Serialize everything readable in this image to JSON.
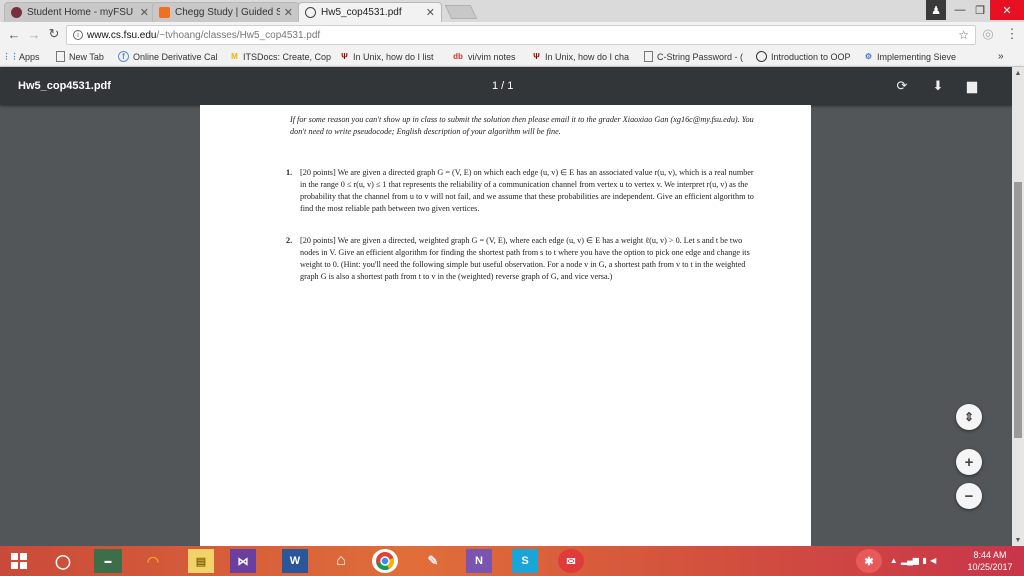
{
  "browser": {
    "tabs": [
      {
        "label": "Student Home - myFSU",
        "icon": "fsu-icon",
        "color": "#782f40"
      },
      {
        "label": "Chegg Study | Guided So",
        "icon": "chegg-icon",
        "color": "#f26f21"
      },
      {
        "label": "Hw5_cop4531.pdf",
        "icon": "globe-icon",
        "color": "#333333"
      }
    ],
    "url_host": "www.cs.fsu.edu",
    "url_path": "/~tvhoang/classes/Hw5_cop4531.pdf",
    "bookmarks": [
      {
        "label": "Apps",
        "icon": "apps-grid-icon"
      },
      {
        "label": "New Tab",
        "icon": "page-icon"
      },
      {
        "label": "Online Derivative Cal",
        "icon": "derivative-icon"
      },
      {
        "label": "ITSDocs: Create, Cop",
        "icon": "itsdocs-icon"
      },
      {
        "label": "In Unix, how do I list",
        "icon": "iu-icon"
      },
      {
        "label": "vi/vim notes",
        "icon": "db-icon"
      },
      {
        "label": "In Unix, how do I cha",
        "icon": "iu-icon"
      },
      {
        "label": "C-String Password - (",
        "icon": "page-icon"
      },
      {
        "label": "Introduction to OOP",
        "icon": "globe-icon"
      },
      {
        "label": "Implementing Sieve",
        "icon": "implementing-icon"
      }
    ],
    "bookmarks_overflow": "»"
  },
  "pdf": {
    "title": "Hw5_cop4531.pdf",
    "page_indicator": "1 / 1",
    "intro": "If for some reason you can't show up in class to submit the solution then please email it to the grader Xiaoxiao Gan (xg16c@my.fsu.edu). You don't need to write pseudocode; English description of your algorithm will be fine.",
    "problems": [
      {
        "number": "1.",
        "text": "[20 points] We are given a directed graph G = (V, E) on which each edge (u, v) ∈ E has an associated value r(u, v), which is a real number in the range 0 ≤ r(u, v) ≤ 1 that represents the reliability of a communication channel from vertex u to vertex v. We interpret r(u, v) as the probability that the channel from u to v will not fail, and we assume that these probabilities are independent. Give an efficient algorithm to find the most reliable path between two given vertices."
      },
      {
        "number": "2.",
        "text": "[20 points] We are given a directed, weighted graph G = (V, E), where each edge (u, v) ∈ E has a weight ℓ(u, v) > 0. Let s and t be two nodes in V. Give an efficient algorithm for finding the shortest path from s to t where you have the option to pick one edge and change its weight to 0. (Hint: you'll need the following simple but useful observation. For a node v in G, a shortest path from v to t in the weighted graph G is also a shortest path from t to v in the (weighted) reverse graph of G, and vice versa.)"
      }
    ]
  },
  "zoom": {
    "fit": "⇕",
    "plus": "+",
    "minus": "−"
  },
  "taskbar": {
    "time": "8:44 AM",
    "date": "10/25/2017"
  },
  "colors": {
    "tabstrip": "#dadada",
    "pdf_toolbar": "#323639",
    "viewer_bg": "#525659",
    "taskbar": "#d2503e"
  }
}
